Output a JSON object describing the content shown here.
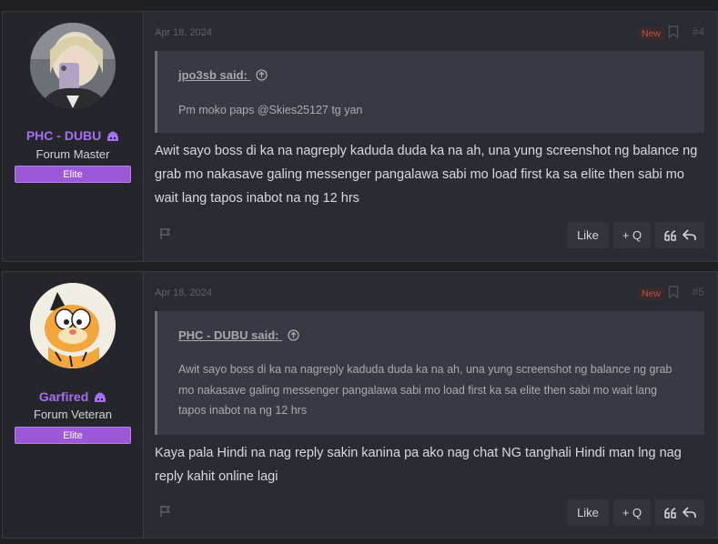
{
  "posts": [
    {
      "user": {
        "name": "PHC - DUBU",
        "title": "Forum Master",
        "banner": "Elite"
      },
      "date": "Apr 18, 2024",
      "new_badge": "New",
      "post_number": "#4",
      "quote": {
        "author": "jpo3sb said:",
        "text": "Pm moko paps @Skies25127 tg yan"
      },
      "message": "Awit sayo boss di ka na nagreply kaduda duda ka na ah, una yung screenshot ng balance ng grab mo nakasave galing messenger pangalawa sabi mo load first ka sa elite then sabi mo wait lang tapos inabot na ng 12 hrs",
      "actions": {
        "like": "Like",
        "multiquote": "+ Q"
      }
    },
    {
      "user": {
        "name": "Garfired",
        "title": "Forum Veteran",
        "banner": "Elite"
      },
      "date": "Apr 18, 2024",
      "new_badge": "New",
      "post_number": "#5",
      "quote": {
        "author": "PHC - DUBU said:",
        "text": "Awit sayo boss di ka na nagreply kaduda duda ka na ah, una yung screenshot ng balance ng grab mo nakasave galing messenger pangalawa sabi mo load first ka sa elite then sabi mo wait lang tapos inabot na ng 12 hrs"
      },
      "message": "Kaya pala Hindi na nag reply sakin kanina pa ako nag chat NG tanghali Hindi man lng nag reply kahit online lagi",
      "actions": {
        "like": "Like",
        "multiquote": "+ Q"
      }
    }
  ],
  "colors": {
    "username": "#a66ef0",
    "banner": "#9b59d8",
    "new_badge": "#b5564f"
  },
  "icons": [
    "rank-icon",
    "bookmark-icon",
    "quote-arrow-icon",
    "report-flag-icon",
    "quote-icon",
    "reply-icon"
  ]
}
